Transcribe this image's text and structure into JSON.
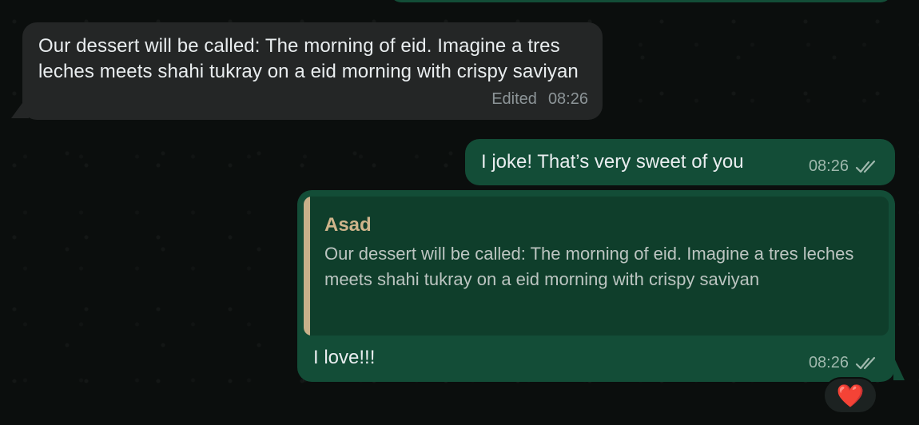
{
  "messages": {
    "incoming": {
      "text": "Our dessert will be called: The morning of eid. Imagine a tres leches meets shahi tukray on a eid morning with crispy saviyan",
      "edited_label": "Edited",
      "time": "08:26"
    },
    "outgoing_1": {
      "text": "I joke! That’s very sweet of you",
      "time": "08:26",
      "status_icon": "double-check-icon"
    },
    "outgoing_2": {
      "quoted_author": "Asad",
      "quoted_text": "Our dessert will be called: The morning of eid. Imagine a tres leches meets shahi tukray on a eid morning with crispy saviyan",
      "text": "I love!!!",
      "time": "08:26",
      "status_icon": "double-check-icon",
      "reaction": "❤️"
    }
  },
  "colors": {
    "background": "#0b0e0d",
    "incoming_bubble": "#242626",
    "outgoing_bubble": "#134d37",
    "quote_bar": "#c8b08a"
  }
}
